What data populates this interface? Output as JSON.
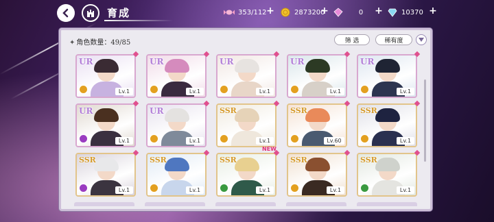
{
  "header": {
    "title": "育成"
  },
  "currencies": [
    {
      "name": "stamina",
      "value": "353/112",
      "icon": "candy-icon",
      "color": "#f4a0c8"
    },
    {
      "name": "coins",
      "value": "2873200",
      "icon": "gold-coin-icon",
      "color": "#f2c230"
    },
    {
      "name": "pink-gems",
      "value": "0",
      "icon": "pink-gem-icon",
      "color": "#e88ad8"
    },
    {
      "name": "blue-gems",
      "value": "10370",
      "icon": "blue-diamond-icon",
      "color": "#8ad8f0"
    }
  ],
  "panel": {
    "count_label": "角色数量：",
    "count_value": "49/85",
    "filter_label": "筛 选",
    "rarity_label": "稀有度"
  },
  "cards": [
    {
      "rarity": "UR",
      "level": "Lv.1",
      "attr_color": "#e3a020",
      "hair": "#3a2b33",
      "outfit": "#c7b2e0",
      "bg": "#e9dff2",
      "new": false
    },
    {
      "rarity": "UR",
      "level": "Lv.1",
      "attr_color": "#e3a020",
      "hair": "#d58bbd",
      "outfit": "#3a2a3f",
      "bg": "#f1dbe8",
      "new": false
    },
    {
      "rarity": "UR",
      "level": "Lv.1",
      "attr_color": "#e3a020",
      "hair": "#e7e3e0",
      "outfit": "#e8d6c8",
      "bg": "#f1e7e3",
      "new": false
    },
    {
      "rarity": "UR",
      "level": "Lv.1",
      "attr_color": "#e3a020",
      "hair": "#2c3a24",
      "outfit": "#d7d0c8",
      "bg": "#d9e6ea",
      "new": false
    },
    {
      "rarity": "UR",
      "level": "Lv.1",
      "attr_color": "#e3a020",
      "hair": "#1f2434",
      "outfit": "#2d3550",
      "bg": "#dde6f0",
      "new": false
    },
    {
      "rarity": "UR",
      "level": "Lv.1",
      "attr_color": "#9a3cc0",
      "hair": "#4a3020",
      "outfit": "#3a3040",
      "bg": "#e0d8d0",
      "new": false
    },
    {
      "rarity": "UR",
      "level": "Lv.1",
      "attr_color": "#e3a020",
      "hair": "#e4e2e0",
      "outfit": "#7f8a9a",
      "bg": "#e7e2ee",
      "new": false
    },
    {
      "rarity": "SSR",
      "level": "Lv.1",
      "attr_color": "#e3a020",
      "hair": "#e6d3b8",
      "outfit": "#efe7dc",
      "bg": "#f0ebe0",
      "new": false
    },
    {
      "rarity": "SSR",
      "level": "Lv.60",
      "attr_color": "#e3a020",
      "hair": "#e98a5a",
      "outfit": "#4a5a70",
      "bg": "#f5e2d4",
      "new": false
    },
    {
      "rarity": "SSR",
      "level": "Lv.1",
      "attr_color": "#e3a020",
      "hair": "#1e2340",
      "outfit": "#2a3050",
      "bg": "#e0e0e8",
      "new": false
    },
    {
      "rarity": "SSR",
      "level": "Lv.1",
      "attr_color": "#9a3cc0",
      "hair": "#e8e8ea",
      "outfit": "#3b3440",
      "bg": "#d9d3dc",
      "new": false
    },
    {
      "rarity": "SSR",
      "level": "Lv.1",
      "attr_color": "#e3a020",
      "hair": "#4f77c0",
      "outfit": "#c8d6ec",
      "bg": "#e0eaf5",
      "new": false
    },
    {
      "rarity": "SSR",
      "level": "Lv.1",
      "attr_color": "#3a9a40",
      "hair": "#e8d090",
      "outfit": "#2f5a4a",
      "bg": "#e8eee4",
      "new": true
    },
    {
      "rarity": "SSR",
      "level": "Lv.1",
      "attr_color": "#e3a020",
      "hair": "#8a5030",
      "outfit": "#3a2a22",
      "bg": "#f0e0d0",
      "new": false
    },
    {
      "rarity": "SSR",
      "level": "Lv.1",
      "attr_color": "#3a9a40",
      "hair": "#cfd2cc",
      "outfit": "#e4e4e0",
      "bg": "#e2e8e0",
      "new": false
    }
  ],
  "new_badge": "NEW"
}
